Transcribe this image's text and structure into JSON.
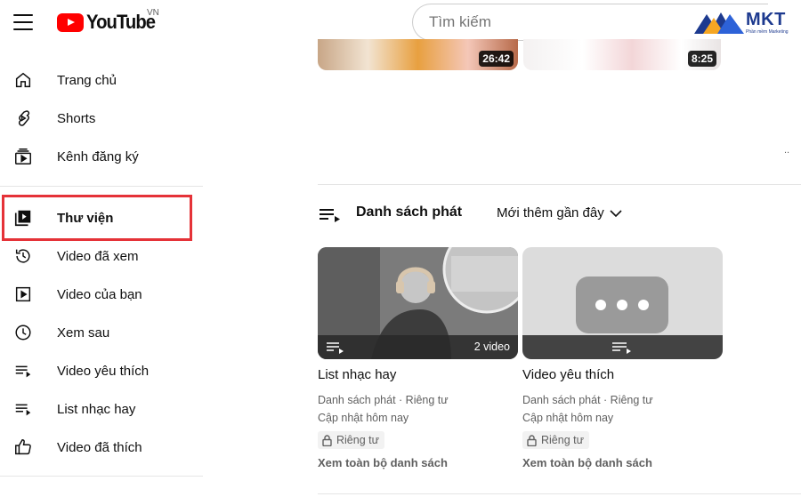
{
  "header": {
    "logo_text": "YouTube",
    "country_code": "VN",
    "search_placeholder": "Tìm kiếm",
    "watermark_brand": "MKT",
    "watermark_sub": "Phần mềm Marketing"
  },
  "sidebar": {
    "items": [
      {
        "label": "Trang chủ",
        "icon": "home-icon"
      },
      {
        "label": "Shorts",
        "icon": "shorts-icon"
      },
      {
        "label": "Kênh đăng ký",
        "icon": "subscriptions-icon"
      },
      {
        "label": "Thư viện",
        "icon": "library-icon",
        "selected": true
      },
      {
        "label": "Video đã xem",
        "icon": "history-icon"
      },
      {
        "label": "Video của bạn",
        "icon": "your-videos-icon"
      },
      {
        "label": "Xem sau",
        "icon": "watch-later-icon"
      },
      {
        "label": "Video yêu thích",
        "icon": "playlist-icon"
      },
      {
        "label": "List nhạc hay",
        "icon": "playlist-icon"
      },
      {
        "label": "Video đã thích",
        "icon": "like-icon"
      }
    ]
  },
  "top_videos": [
    {
      "duration": "26:42"
    },
    {
      "duration": "8:25"
    }
  ],
  "playlists_section": {
    "title": "Danh sách phát",
    "sort_label": "Mới thêm gần đây",
    "cards": [
      {
        "title": "List nhạc hay",
        "video_count": "2 video",
        "meta_line1": "Danh sách phát · Riêng tư",
        "meta_line2": "Cập nhật hôm nay",
        "privacy": "Riêng tư",
        "view_all": "Xem toàn bộ danh sách"
      },
      {
        "title": "Video yêu thích",
        "video_count": "",
        "meta_line1": "Danh sách phát · Riêng tư",
        "meta_line2": "Cập nhật hôm nay",
        "privacy": "Riêng tư",
        "view_all": "Xem toàn bộ danh sách"
      }
    ]
  },
  "colors": {
    "brand_red": "#ff0000",
    "highlight_box": "#e53238",
    "mkt_blue": "#1d3a8f",
    "mkt_orange": "#f5a623"
  }
}
